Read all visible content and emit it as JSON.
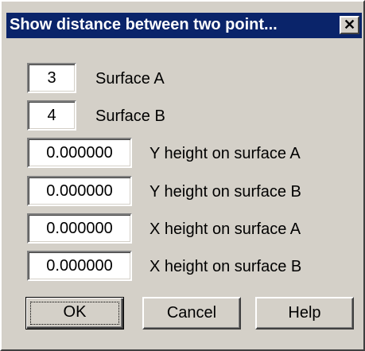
{
  "window": {
    "title": "Show distance between two point...",
    "close_label": "✕"
  },
  "fields": [
    {
      "value": "3",
      "label": "Surface A"
    },
    {
      "value": "4",
      "label": "Surface B"
    },
    {
      "value": "0.000000",
      "label": "Y height on surface A"
    },
    {
      "value": "0.000000",
      "label": "Y height on surface B"
    },
    {
      "value": "0.000000",
      "label": "X height on surface A"
    },
    {
      "value": "0.000000",
      "label": "X height on surface B"
    }
  ],
  "buttons": {
    "ok": "OK",
    "cancel": "Cancel",
    "help": "Help"
  },
  "colors": {
    "titlebar": "#0a246a",
    "dialog_face": "#d4d0c8"
  }
}
